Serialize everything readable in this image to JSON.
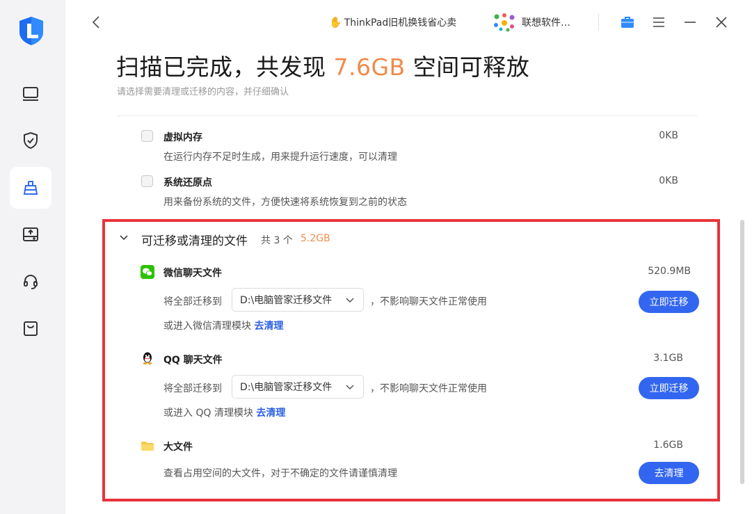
{
  "topbar": {
    "ad_text": "ThinkPad旧机换钱省心卖",
    "partner_text": "联想软件…"
  },
  "header": {
    "title_prefix": "扫描已完成，共发现 ",
    "title_size": "7.6GB",
    "title_suffix": " 空间可释放",
    "subtitle": "请选择需要清理或迁移的内容，并仔细确认"
  },
  "items": [
    {
      "name": "虚拟内存",
      "desc": "在运行内存不足时生成，用来提升运行速度，可以清理",
      "size": "0KB",
      "checked": false
    },
    {
      "name": "系统还原点",
      "desc": "用来备份系统的文件，方便快速将系统恢复到之前的状态",
      "size": "0KB",
      "checked": false
    }
  ],
  "group": {
    "title": "可迁移或清理的文件",
    "count": "共 3 个",
    "size": "5.2GB",
    "wechat": {
      "name": "微信聊天文件",
      "size": "520.9MB",
      "migrate_label": "将全部迁移到",
      "path": "D:\\电脑管家迁移文件",
      "note": "，不影响聊天文件正常使用",
      "alt_text": "或进入微信清理模块",
      "alt_link": "去清理",
      "button": "立即迁移"
    },
    "qq": {
      "name": "QQ 聊天文件",
      "size": "3.1GB",
      "migrate_label": "将全部迁移到",
      "path": "D:\\电脑管家迁移文件",
      "note": "，不影响聊天文件正常使用",
      "alt_text": "或进入 QQ 清理模块",
      "alt_link": "去清理",
      "button": "立即迁移"
    },
    "bigfile": {
      "name": "大文件",
      "size": "1.6GB",
      "desc": "查看占用空间的大文件，对于不确定的文件请谨慎清理",
      "button": "去清理"
    }
  },
  "colors": {
    "accent": "#3366f0",
    "highlight": "#f08a4b",
    "link": "#2b5fe3",
    "annotation_border": "#e8333b"
  }
}
